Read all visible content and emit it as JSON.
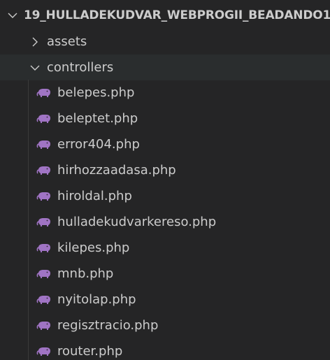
{
  "explorer": {
    "root": {
      "label": "19_HULLADEKUDVAR_WEBPROGII_BEADANDO1",
      "expanded": true,
      "icon": "chevron-down-icon"
    },
    "folders": [
      {
        "label": "assets",
        "expanded": false,
        "icon": "chevron-right-icon"
      },
      {
        "label": "controllers",
        "expanded": true,
        "icon": "chevron-down-icon"
      }
    ],
    "files": [
      {
        "label": "belepes.php",
        "icon": "php-elephant-icon"
      },
      {
        "label": "beleptet.php",
        "icon": "php-elephant-icon"
      },
      {
        "label": "error404.php",
        "icon": "php-elephant-icon"
      },
      {
        "label": "hirhozzaadasa.php",
        "icon": "php-elephant-icon"
      },
      {
        "label": "hiroldal.php",
        "icon": "php-elephant-icon"
      },
      {
        "label": "hulladekudvarkereso.php",
        "icon": "php-elephant-icon"
      },
      {
        "label": "kilepes.php",
        "icon": "php-elephant-icon"
      },
      {
        "label": "mnb.php",
        "icon": "php-elephant-icon"
      },
      {
        "label": "nyitolap.php",
        "icon": "php-elephant-icon"
      },
      {
        "label": "regisztracio.php",
        "icon": "php-elephant-icon"
      },
      {
        "label": "router.php",
        "icon": "php-elephant-icon"
      }
    ],
    "colors": {
      "background": "#252526",
      "text": "#cccccc",
      "php_icon": "#a074c4"
    }
  }
}
